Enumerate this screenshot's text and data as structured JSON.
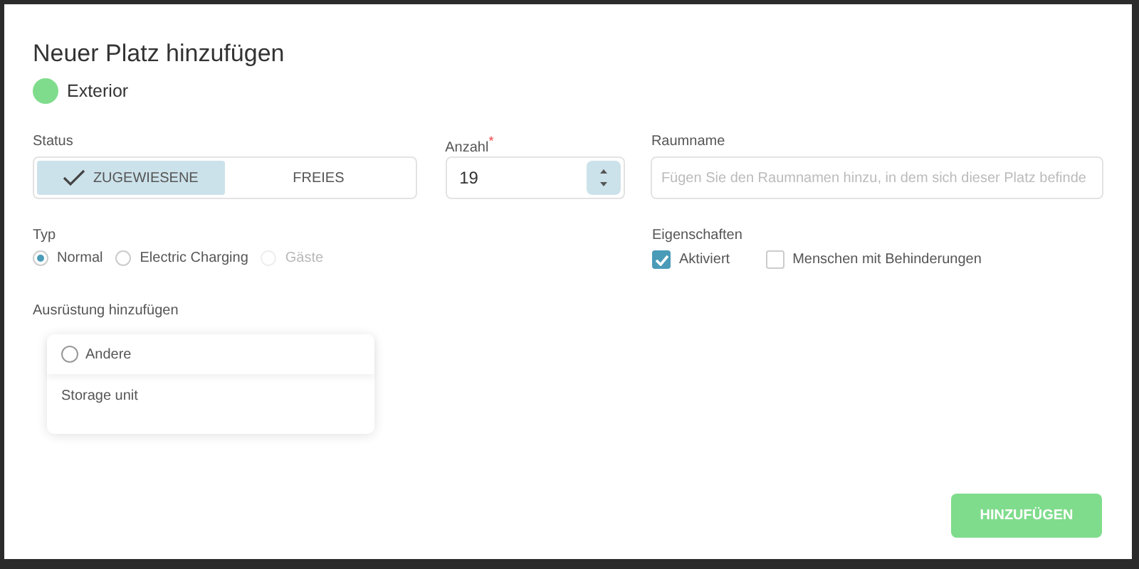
{
  "dialog": {
    "title": "Neuer Platz hinzufügen"
  },
  "zone": {
    "label": "Exterior",
    "color": "#7fdc8c"
  },
  "status": {
    "label": "Status",
    "options": [
      {
        "label": "ZUGEWIESENE",
        "selected": true
      },
      {
        "label": "FREIES",
        "selected": false
      }
    ]
  },
  "count": {
    "label": "Anzahl",
    "required_mark": "*",
    "value": "19"
  },
  "room": {
    "label": "Raumname",
    "placeholder": "Fügen Sie den Raumnamen hinzu, in dem sich dieser Platz befinde"
  },
  "type": {
    "label": "Typ",
    "options": [
      {
        "label": "Normal",
        "selected": true,
        "disabled": false
      },
      {
        "label": "Electric Charging",
        "selected": false,
        "disabled": false
      },
      {
        "label": "Gäste",
        "selected": false,
        "disabled": true
      }
    ]
  },
  "properties": {
    "label": "Eigenschaften",
    "options": [
      {
        "label": "Aktiviert",
        "checked": true
      },
      {
        "label": "Menschen mit Behinderungen",
        "checked": false
      }
    ]
  },
  "equipment": {
    "label": "Ausrüstung hinzufügen",
    "card": {
      "option": {
        "label": "Andere",
        "selected": false
      },
      "item": "Storage unit"
    }
  },
  "submit": "HINZUFÜGEN"
}
